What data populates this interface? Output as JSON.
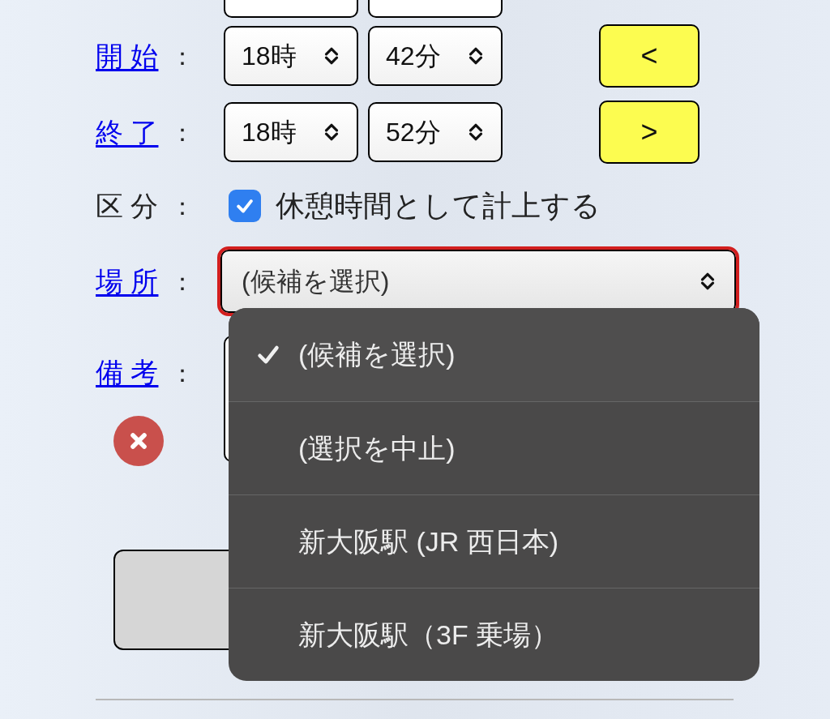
{
  "rows": [
    {
      "kind": "cut"
    },
    {
      "kind": "time",
      "label": "開 始",
      "colon": "：",
      "hour": "18時",
      "minute": "42分",
      "step_button": "<"
    },
    {
      "kind": "time",
      "label": "終 了",
      "colon": "：",
      "hour": "18時",
      "minute": "52分",
      "step_button": ">"
    },
    {
      "kind": "check",
      "label": "区 分",
      "colon": "：",
      "checked": true,
      "text": "休憩時間として計上する"
    },
    {
      "kind": "select",
      "label": "場 所",
      "colon": "：",
      "value": "(候補を選択)",
      "focused": true
    },
    {
      "kind": "note",
      "label": "備 考",
      "colon": "："
    }
  ],
  "menu": {
    "options": [
      {
        "label": "(候補を選択)",
        "selected": true
      },
      {
        "label": "(選択を中止)",
        "selected": false
      },
      {
        "label": "新大阪駅 (JR 西日本)",
        "selected": false
      },
      {
        "label": "新大阪駅（3F 乗場）",
        "selected": false
      }
    ]
  }
}
